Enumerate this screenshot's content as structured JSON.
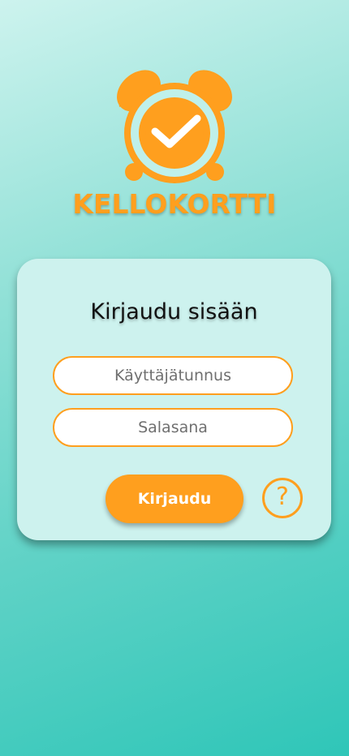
{
  "brand": {
    "name": "KELLOKORTTI",
    "logo_icon": "alarm-clock-check-icon",
    "color": "#ff9f1e"
  },
  "login": {
    "title": "Kirjaudu sisään",
    "username_placeholder": "Käyttäjätunnus",
    "password_placeholder": "Salasana",
    "submit_label": "Kirjaudu",
    "help_label": "?",
    "help_icon": "question-circle-icon"
  },
  "colors": {
    "accent": "#ff9f1e",
    "card_bg": "#cdf2ee",
    "bg_top": "#cdf3ee",
    "bg_bottom": "#2fc6b8"
  }
}
